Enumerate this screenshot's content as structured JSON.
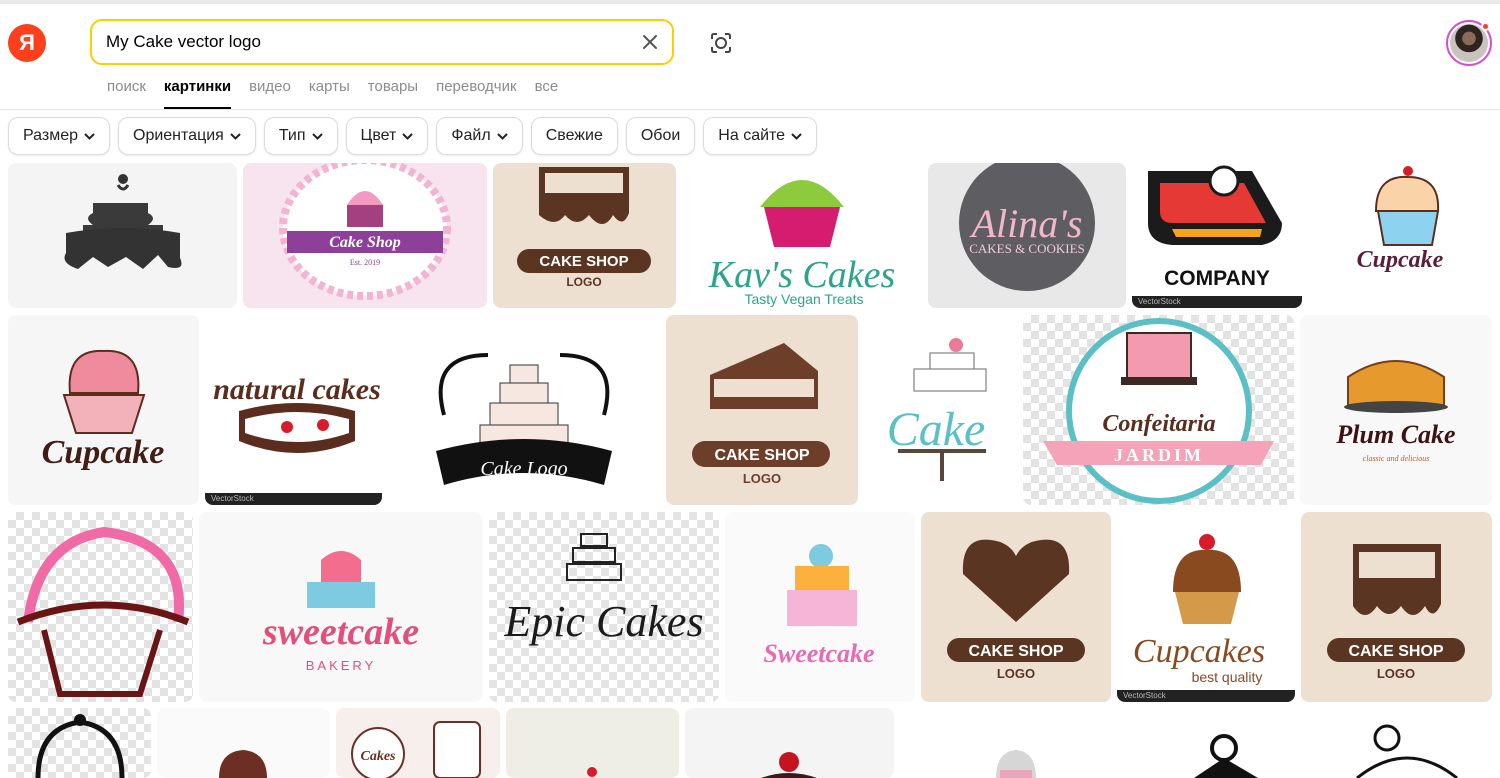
{
  "brand": {
    "logo_letter": "Я",
    "logo_color": "#fc3f1d"
  },
  "search": {
    "value": "My Cake vector logo",
    "focus_color": "#ffcc00"
  },
  "tabs": [
    {
      "label": "поиск",
      "active": false
    },
    {
      "label": "картинки",
      "active": true
    },
    {
      "label": "видео",
      "active": false
    },
    {
      "label": "карты",
      "active": false
    },
    {
      "label": "товары",
      "active": false
    },
    {
      "label": "переводчик",
      "active": false
    },
    {
      "label": "все",
      "active": false
    }
  ],
  "filters": [
    {
      "label": "Размер",
      "dropdown": true
    },
    {
      "label": "Ориентация",
      "dropdown": true
    },
    {
      "label": "Тип",
      "dropdown": true
    },
    {
      "label": "Цвет",
      "dropdown": true
    },
    {
      "label": "Файл",
      "dropdown": true
    },
    {
      "label": "Свежие",
      "dropdown": false
    },
    {
      "label": "Обои",
      "dropdown": false
    },
    {
      "label": "На сайте",
      "dropdown": true
    }
  ],
  "images": {
    "r1": [
      {
        "id": "silhouette-cake",
        "caption": ""
      },
      {
        "id": "cake-shop-badge",
        "caption": "Cake Shop",
        "caption2": "Est. 2019"
      },
      {
        "id": "cake-shop-logo-brown",
        "caption": "CAKE SHOP",
        "caption2": "LOGO"
      },
      {
        "id": "kavs-cakes",
        "caption": "Kav's Cakes",
        "caption2": "Tasty Vegan Treats"
      },
      {
        "id": "alinas",
        "caption": "Alina's",
        "caption2": "CAKES & COOKIES"
      },
      {
        "id": "pie-company",
        "caption": "COMPANY",
        "watermark": "VectorStock"
      },
      {
        "id": "cupcake-blue",
        "caption": "Cupcake"
      }
    ],
    "r2": [
      {
        "id": "cupcake-pink",
        "caption": "Cupcake"
      },
      {
        "id": "natural-cakes",
        "caption": "natural cakes",
        "watermark": "VectorStock"
      },
      {
        "id": "cake-logo-ornate",
        "caption": "Cake Logo"
      },
      {
        "id": "cake-shop-slice",
        "caption": "CAKE SHOP",
        "caption2": "LOGO"
      },
      {
        "id": "cake-teal",
        "caption": "Cake"
      },
      {
        "id": "confeitaria",
        "caption": "Confeitaria",
        "caption2": "JARDIM"
      },
      {
        "id": "plum-cake",
        "caption": "Plum Cake",
        "caption2": "classic and delicious"
      }
    ],
    "r3": [
      {
        "id": "cupcake-outline",
        "caption": ""
      },
      {
        "id": "sweetcake-bakery",
        "caption": "sweetcake",
        "caption2": "BAKERY"
      },
      {
        "id": "epic-cakes",
        "caption": "Epic Cakes"
      },
      {
        "id": "sweetcake-colorful",
        "caption": "Sweetcake"
      },
      {
        "id": "cake-shop-heart",
        "caption": "CAKE SHOP",
        "caption2": "LOGO"
      },
      {
        "id": "cupcakes-best",
        "caption": "Cupcakes",
        "caption2": "best quality",
        "watermark": "VectorStock"
      },
      {
        "id": "cake-shop-drip",
        "caption": "CAKE SHOP",
        "caption2": "LOGO"
      }
    ],
    "r4": [
      {
        "id": "bakery-ornate",
        "caption": ""
      },
      {
        "id": "cake-small",
        "caption": ""
      },
      {
        "id": "cakes-set",
        "caption": "Cakes"
      },
      {
        "id": "cake-cherry-beige",
        "caption": ""
      },
      {
        "id": "cake-cherry-dark",
        "caption": ""
      },
      {
        "id": "cupcake-gray",
        "caption": ""
      },
      {
        "id": "cake-slice-black",
        "caption": ""
      },
      {
        "id": "cupcake-line",
        "caption": ""
      }
    ]
  }
}
